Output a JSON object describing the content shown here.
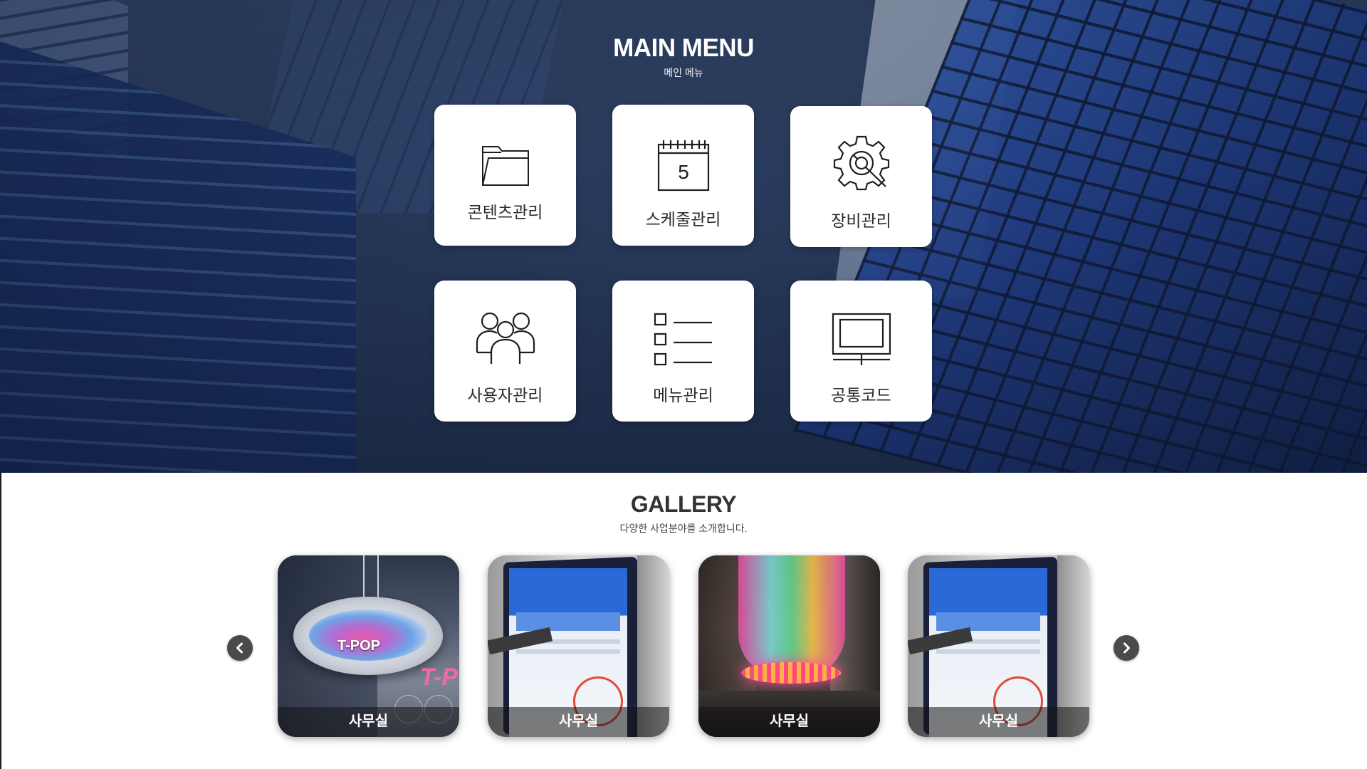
{
  "header": {
    "title": "MAIN MENU",
    "subtitle": "메인 메뉴"
  },
  "menu": {
    "items": [
      {
        "label": "콘텐츠관리",
        "icon": "folder-icon"
      },
      {
        "label": "스케줄관리",
        "icon": "calendar-icon",
        "icon_text": "5"
      },
      {
        "label": "장비관리",
        "icon": "gear-icon"
      },
      {
        "label": "사용자관리",
        "icon": "users-icon"
      },
      {
        "label": "메뉴관리",
        "icon": "list-icon"
      },
      {
        "label": "공통코드",
        "icon": "monitor-icon"
      }
    ]
  },
  "gallery": {
    "title": "GALLERY",
    "subtitle": "다양한 사업분야를 소개합니다.",
    "prev_icon": "chevron-left-icon",
    "next_icon": "chevron-right-icon",
    "items": [
      {
        "caption": "사무실",
        "overlay_text": "T-POP",
        "overlay_text_2": "T-P"
      },
      {
        "caption": "사무실"
      },
      {
        "caption": "사무실"
      },
      {
        "caption": "사무실"
      }
    ]
  },
  "colors": {
    "hero_bg": "#2a3d60",
    "card_bg": "#ffffff",
    "text_dark": "#2b2b2b",
    "arrow_bg": "#4a4a4a"
  }
}
